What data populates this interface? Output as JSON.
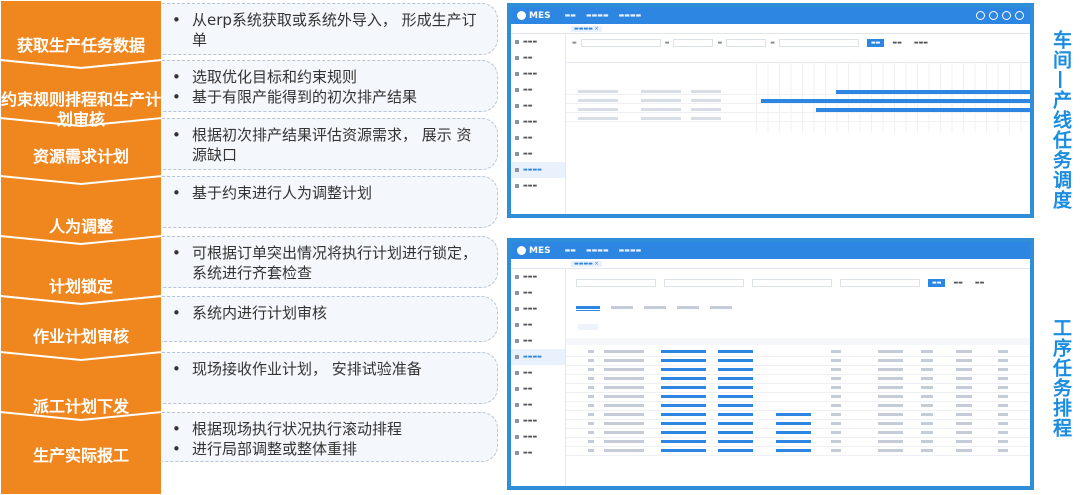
{
  "steps": [
    {
      "label": "获取生产任务数据"
    },
    {
      "label": "约束规则排程和生产计划审核"
    },
    {
      "label": "资源需求计划"
    },
    {
      "label": "人为调整"
    },
    {
      "label": "计划锁定"
    },
    {
      "label": "作业计划审核"
    },
    {
      "label": "派工计划下发"
    },
    {
      "label": "生产实际报工"
    }
  ],
  "descriptions": [
    {
      "lines": [
        "从erp系统获取或系统外导入， 形成生产订单"
      ]
    },
    {
      "lines": [
        "选取优化目标和约束规则",
        "基于有限产能得到的初次排产结果"
      ]
    },
    {
      "lines": [
        "根据初次排产结果评估资源需求， 展示 资源缺口"
      ]
    },
    {
      "lines": [
        "基于约束进行人为调整计划"
      ]
    },
    {
      "lines": [
        "可根据订单突出情况将执行计划进行锁定， 系统进行齐套检查"
      ]
    },
    {
      "lines": [
        "系统内进行计划审核"
      ]
    },
    {
      "lines": [
        "现场接收作业计划， 安排试验准备"
      ]
    },
    {
      "lines": [
        "根据现场执行状况执行滚动排程",
        "进行局部调整或整体重排"
      ]
    }
  ],
  "screenshot_top": {
    "logo": "MES",
    "caption": "车间—产线任务调度"
  },
  "screenshot_bottom": {
    "logo": "MES",
    "caption": "工序任务排程"
  },
  "colors": {
    "accent_orange": "#f0861e",
    "accent_blue": "#2d86e2",
    "caption_blue": "#1a8de0"
  }
}
